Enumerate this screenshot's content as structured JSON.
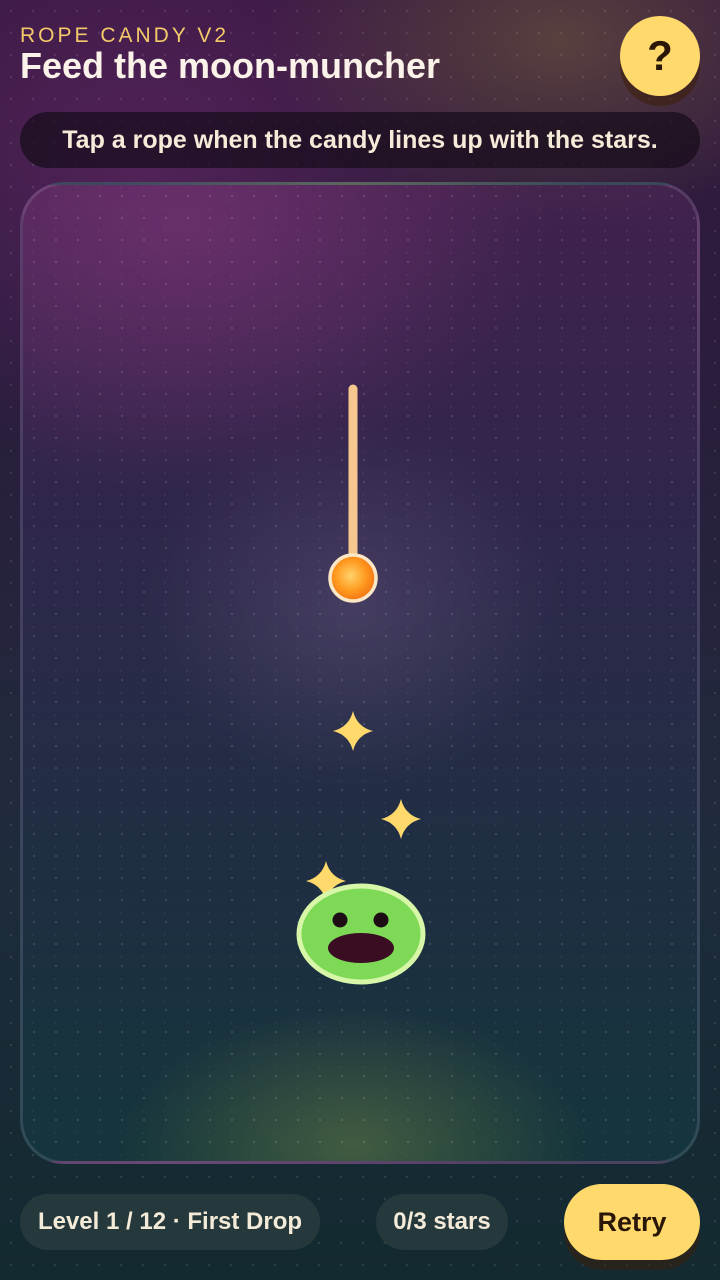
{
  "header": {
    "eyebrow": "ROPE CANDY V2",
    "title": "Feed the moon-muncher",
    "help_label": "?"
  },
  "hint": "Tap a rope when the candy lines up with the stars.",
  "board": {
    "rope_color": "#f6c88f",
    "candy_color": "#ff9a1f",
    "star_color": "#ffd96b",
    "muncher_color": "#7ed957",
    "stars_total": 3
  },
  "footer": {
    "level_label": "Level 1 / 12 · First Drop",
    "stars_label": "0/3 stars",
    "retry_label": "Retry"
  },
  "colors": {
    "accent": "#ffd96b",
    "eyebrow": "#f4c96a"
  }
}
